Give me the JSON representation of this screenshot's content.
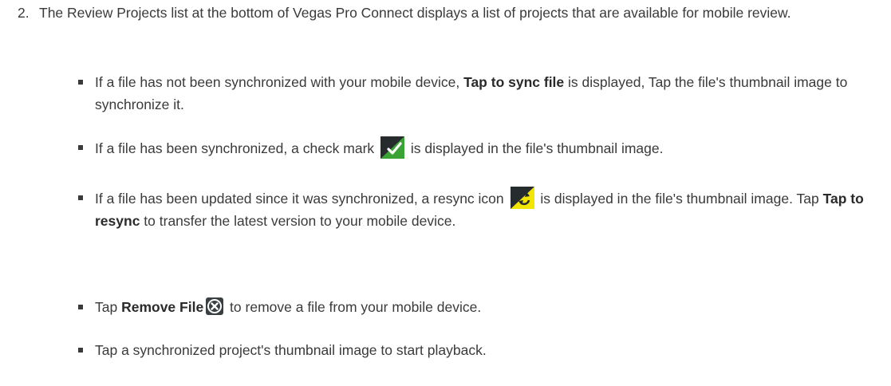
{
  "step": {
    "number": "2.",
    "text": "The Review Projects list at the bottom of Vegas Pro Connect displays a list of projects that are available for mobile review."
  },
  "bullets": [
    {
      "pre": "If a file has not been synchronized with your mobile device, ",
      "label": "Tap to sync file",
      "post": " is displayed, Tap the file's thumbnail image to synchronize it."
    },
    {
      "pre": "If a file has been synchronized, a check mark ",
      "icon": "check-mark-icon",
      "post": " is displayed in the file's thumbnail image."
    },
    {
      "pre": "If a file has been updated since it was synchronized, a resync icon ",
      "icon": "resync-icon",
      "mid": " is displayed in the file's thumbnail image. Tap ",
      "label": "Tap to resync",
      "post": " to transfer the latest version to your mobile device."
    },
    {
      "pre": "Tap ",
      "label": "Remove File",
      "icon": "remove-file-icon",
      "post": " to remove a file from your mobile device."
    },
    {
      "text": "Tap a synchronized project's thumbnail image to start playback."
    }
  ],
  "colors": {
    "text": "#3a3a3a",
    "check_green": "#3aa335",
    "resync_yellow": "#f2e600",
    "icon_dark": "#262b2e"
  }
}
